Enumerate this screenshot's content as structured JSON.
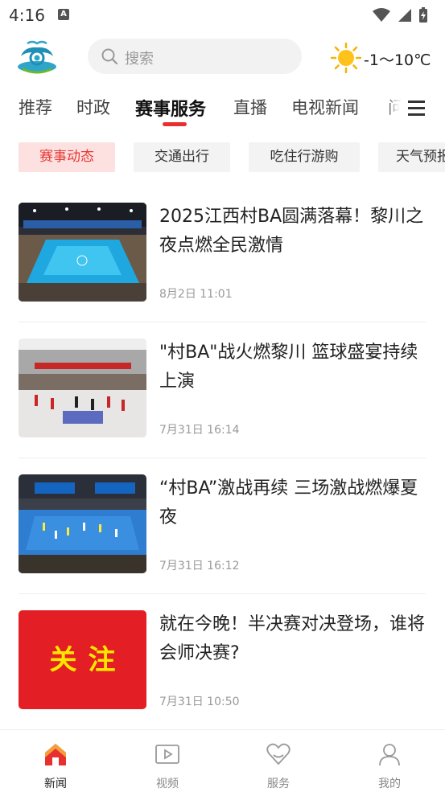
{
  "status_bar": {
    "time": "4:16",
    "notification_icon": "A"
  },
  "header": {
    "search_placeholder": "搜索",
    "weather_temp": "-1～10℃"
  },
  "tabs": [
    {
      "label": "推荐"
    },
    {
      "label": "时政"
    },
    {
      "label": "赛事服务",
      "active": true
    },
    {
      "label": "直播"
    },
    {
      "label": "电视新闻"
    },
    {
      "label": "问"
    }
  ],
  "chips": [
    {
      "label": "赛事动态",
      "active": true
    },
    {
      "label": "交通出行"
    },
    {
      "label": "吃住行游购"
    },
    {
      "label": "天气预报"
    }
  ],
  "news": [
    {
      "title": "2025江西村BA圆满落幕！黎川之夜点燃全民激情",
      "time": "8月2日 11:01"
    },
    {
      "title": "\"村BA\"战火燃黎川 篮球盛宴持续上演",
      "time": "7月31日 16:14"
    },
    {
      "title": "“村BA”激战再续 三场激战燃爆夏夜",
      "time": "7月31日 16:12"
    },
    {
      "title": "就在今晚！半决赛对决登场，谁将会师决赛?",
      "time": "7月31日 10:50",
      "thumb_text": "关注"
    }
  ],
  "bottom_nav": [
    {
      "label": "新闻",
      "active": true
    },
    {
      "label": "视频"
    },
    {
      "label": "服务"
    },
    {
      "label": "我的"
    }
  ],
  "colors": {
    "accent": "#e8312f",
    "chip_active_bg": "#fde1e1",
    "thumb_red": "#e31e24",
    "thumb_yellow": "#ffe600"
  }
}
